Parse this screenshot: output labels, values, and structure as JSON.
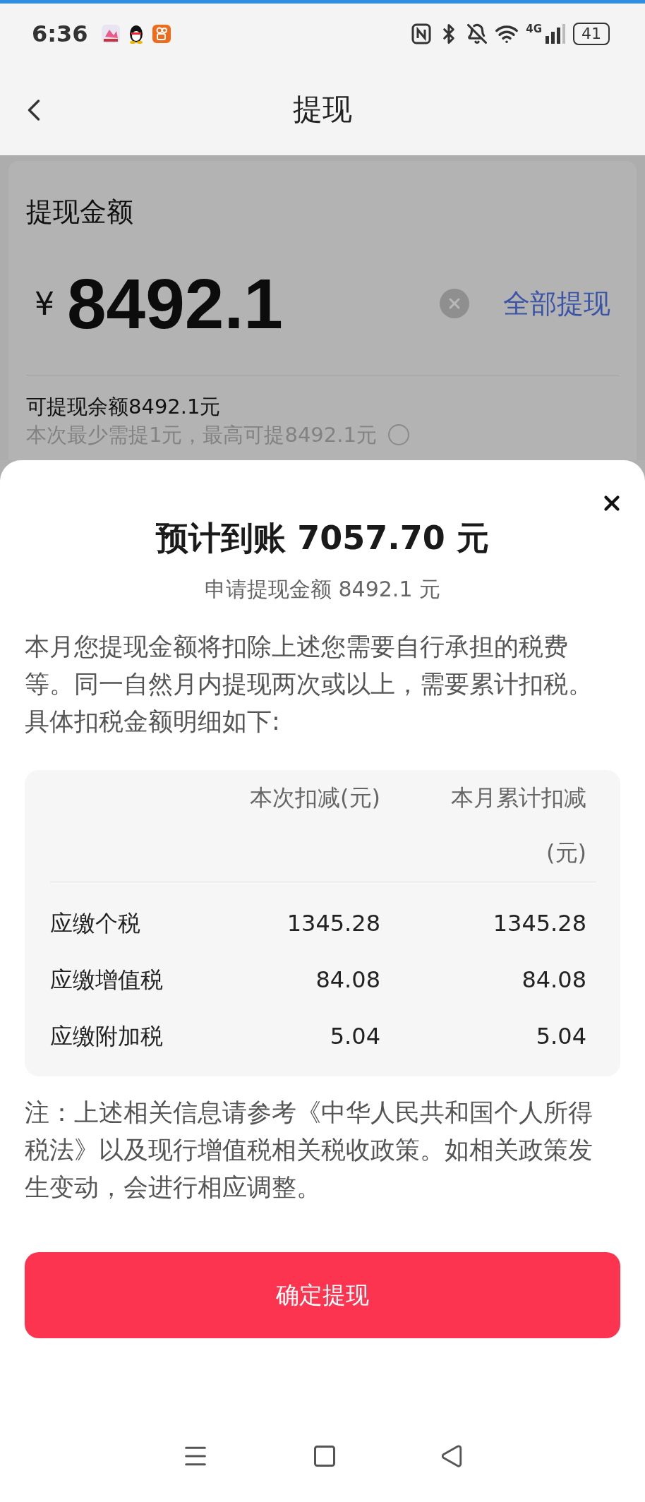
{
  "status_bar": {
    "time": "6:36",
    "network": "4G",
    "battery": "41"
  },
  "nav": {
    "title": "提现"
  },
  "withdraw_form": {
    "label": "提现金额",
    "currency": "¥",
    "amount": "8492.1",
    "all_button": "全部提现",
    "balance": "可提现余额8492.1元",
    "limits": "本次最少需提1元，最高可提8492.1元"
  },
  "sheet": {
    "title": "预计到账 7057.70 元",
    "subtitle": "申请提现金额 8492.1 元",
    "description": "本月您提现金额将扣除上述您需要自行承担的税费等。同一自然月内提现两次或以上，需要累计扣税。具体扣税金额明细如下:",
    "table": {
      "columns": [
        "本次扣减(元)",
        "本月累计扣减(元)"
      ],
      "rows": [
        {
          "label": "应缴个税",
          "current": "1345.28",
          "month_total": "1345.28"
        },
        {
          "label": "应缴增值税",
          "current": "84.08",
          "month_total": "84.08"
        },
        {
          "label": "应缴附加税",
          "current": "5.04",
          "month_total": "5.04"
        }
      ]
    },
    "note": "注：上述相关信息请参考《中华人民共和国个人所得税法》以及现行增值税相关税收政策。如相关政策发生变动，会进行相应调整。",
    "confirm_button": "确定提现"
  }
}
